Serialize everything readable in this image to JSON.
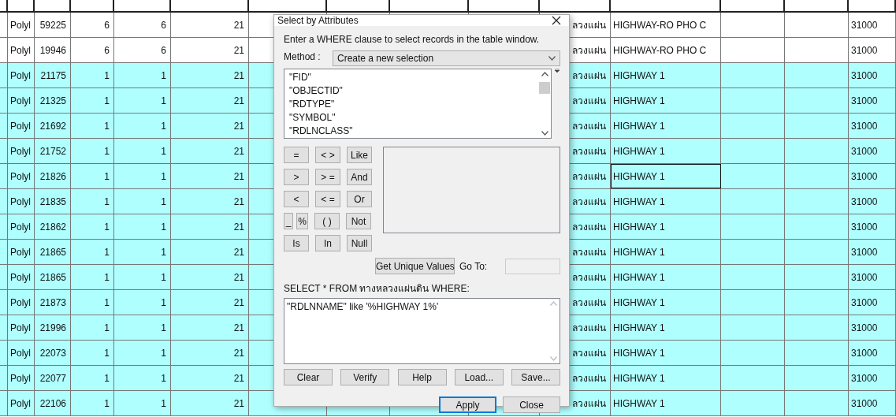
{
  "table": {
    "rows": [
      {
        "selected": false,
        "current": false,
        "cells": [
          "Polyl",
          "59225",
          "6",
          "6",
          "21",
          "ลวงแผ่น",
          "HIGHWAY-RO PHO C",
          "31000"
        ]
      },
      {
        "selected": false,
        "current": false,
        "cells": [
          "Polyl",
          "19946",
          "6",
          "6",
          "21",
          "ลวงแผ่น",
          "HIGHWAY-RO PHO C",
          "31000"
        ]
      },
      {
        "selected": true,
        "current": false,
        "cells": [
          "Polyl",
          "21175",
          "1",
          "1",
          "21",
          "ลวงแผ่น",
          "HIGHWAY 1",
          "31000"
        ]
      },
      {
        "selected": true,
        "current": false,
        "cells": [
          "Polyl",
          "21325",
          "1",
          "1",
          "21",
          "ลวงแผ่น",
          "HIGHWAY 1",
          "31000"
        ]
      },
      {
        "selected": true,
        "current": false,
        "cells": [
          "Polyl",
          "21692",
          "1",
          "1",
          "21",
          "ลวงแผ่น",
          "HIGHWAY 1",
          "31000"
        ]
      },
      {
        "selected": true,
        "current": false,
        "cells": [
          "Polyl",
          "21752",
          "1",
          "1",
          "21",
          "ลวงแผ่น",
          "HIGHWAY 1",
          "31000"
        ]
      },
      {
        "selected": true,
        "current": true,
        "cells": [
          "Polyl",
          "21826",
          "1",
          "1",
          "21",
          "ลวงแผ่น",
          "HIGHWAY 1",
          "31000"
        ]
      },
      {
        "selected": true,
        "current": false,
        "cells": [
          "Polyl",
          "21835",
          "1",
          "1",
          "21",
          "ลวงแผ่น",
          "HIGHWAY 1",
          "31000"
        ]
      },
      {
        "selected": true,
        "current": false,
        "cells": [
          "Polyl",
          "21862",
          "1",
          "1",
          "21",
          "ลวงแผ่น",
          "HIGHWAY 1",
          "31000"
        ]
      },
      {
        "selected": true,
        "current": false,
        "cells": [
          "Polyl",
          "21865",
          "1",
          "1",
          "21",
          "ลวงแผ่น",
          "HIGHWAY 1",
          "31000"
        ]
      },
      {
        "selected": true,
        "current": false,
        "cells": [
          "Polyl",
          "21865",
          "1",
          "1",
          "21",
          "ลวงแผ่น",
          "HIGHWAY 1",
          "31000"
        ]
      },
      {
        "selected": true,
        "current": false,
        "cells": [
          "Polyl",
          "21873",
          "1",
          "1",
          "21",
          "ลวงแผ่น",
          "HIGHWAY 1",
          "31000"
        ]
      },
      {
        "selected": true,
        "current": false,
        "cells": [
          "Polyl",
          "21996",
          "1",
          "1",
          "21",
          "ลวงแผ่น",
          "HIGHWAY 1",
          "31000"
        ]
      },
      {
        "selected": true,
        "current": false,
        "cells": [
          "Polyl",
          "22073",
          "1",
          "1",
          "21",
          "ลวงแผ่น",
          "HIGHWAY 1",
          "31000"
        ]
      },
      {
        "selected": true,
        "current": false,
        "cells": [
          "Polyl",
          "22077",
          "1",
          "1",
          "21",
          "ลวงแผ่น",
          "HIGHWAY 1",
          "31000"
        ]
      },
      {
        "selected": true,
        "current": false,
        "cells": [
          "Polyl",
          "22106",
          "1",
          "1",
          "21",
          "ลวงแผ่น",
          "HIGHWAY 1",
          "31000"
        ]
      }
    ]
  },
  "dialog": {
    "title": "Select by Attributes",
    "instruction": "Enter a WHERE clause to select records in the table window.",
    "method_label": "Method :",
    "method_value": "Create a new selection",
    "fields": [
      "\"FID\"",
      "\"OBJECTID\"",
      "\"RDTYPE\"",
      "\"SYMBOL\"",
      "\"RDLNCLASS\""
    ],
    "operators": [
      [
        "=",
        "< >",
        "Like"
      ],
      [
        ">",
        "> =",
        "And"
      ],
      [
        "<",
        "< =",
        "Or"
      ],
      [
        "_",
        "%",
        "( )",
        "Not"
      ],
      [
        "Is",
        "In",
        "Null"
      ]
    ],
    "unique_values_button": "Get Unique Values",
    "goto_label": "Go To:",
    "query_label": "SELECT * FROM ทางหลวงแผ่นดิน WHERE:",
    "query": "\"RDLNNAME\" like '%HIGHWAY 1%'",
    "buttons": [
      "Clear",
      "Verify",
      "Help",
      "Load...",
      "Save..."
    ],
    "footer_buttons": [
      {
        "label": "Apply",
        "focused": true
      },
      {
        "label": "Close",
        "focused": false
      }
    ]
  }
}
